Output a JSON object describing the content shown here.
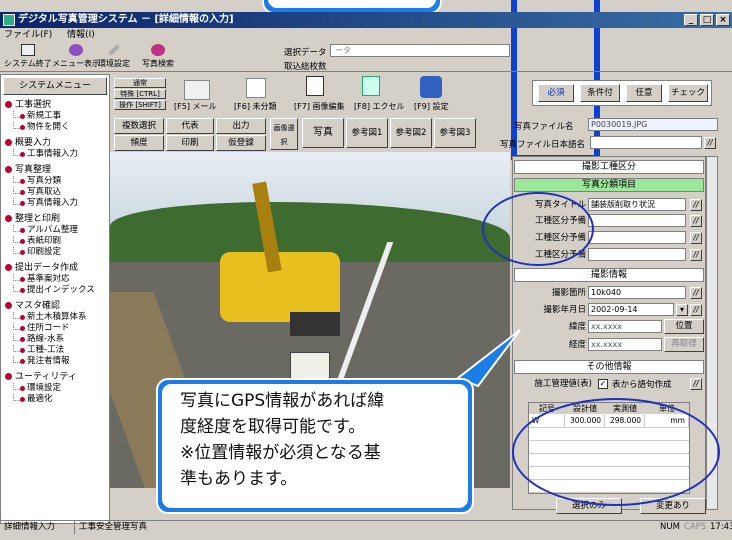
{
  "window": {
    "title": "デジタル写真管理システム － [詳細情報の入力]"
  },
  "menu": [
    "ファイル(F)",
    "情報(I)"
  ],
  "toolbar": [
    {
      "label": "システム終了",
      "icon": "exit-icon"
    },
    {
      "label": "メニュー表示",
      "icon": "menu-icon"
    },
    {
      "label": "環境設定",
      "icon": "settings-icon"
    },
    {
      "label": "写真検索",
      "icon": "search-icon"
    }
  ],
  "select_data": {
    "label": "選択データ",
    "value": "ータ",
    "count_label": "取込総枚数"
  },
  "sidebar": {
    "header": "システムメニュー",
    "groups": [
      {
        "title": "工事選択",
        "items": [
          "新規工事",
          "物件を開く"
        ]
      },
      {
        "title": "概要入力",
        "items": [
          "工事情報入力"
        ]
      },
      {
        "title": "写真整理",
        "items": [
          "写真分類",
          "写真取込",
          "写真情報入力"
        ]
      },
      {
        "title": "整理と印刷",
        "items": [
          "アルバム整理",
          "表紙印刷",
          "印刷設定"
        ]
      },
      {
        "title": "提出データ作成",
        "items": [
          "基準案対応",
          "提出インデックス"
        ]
      },
      {
        "title": "マスタ確認",
        "items": [
          "新土木積算体系",
          "住所コード",
          "路線-水系",
          "工種-工法",
          "発注者情報"
        ]
      },
      {
        "title": "ユーティリティ",
        "items": [
          "環境設定",
          "最適化"
        ]
      }
    ]
  },
  "fkeys": {
    "normal": "通常",
    "ctrl": "特殊 [CTRL]",
    "shift": "操作 [SHIFT]",
    "f5": "[F5] メール",
    "f6": "[F6] 未分類",
    "f7": "[F7] 画像編集",
    "f8": "[F8] エクセル",
    "f9": "[F9] 設定"
  },
  "right_buttons": [
    "必須",
    "条件付",
    "任意",
    "チェック"
  ],
  "tools": {
    "multi_select": "複数選択",
    "representative": "代表",
    "output": "出力",
    "category_select": "画像選択",
    "degree": "頻度",
    "print": "印刷",
    "temp_register": "仮登録"
  },
  "photo_tabs": [
    "写真",
    "参考図1",
    "参考図2",
    "参考図3"
  ],
  "file": {
    "label": "写真ファイル名",
    "value": "P0030019.JPG",
    "jp_label": "写真ファイル日本語名"
  },
  "sections": {
    "shooting_category": "撮影工種区分",
    "photo_class": "写真分類項目",
    "shooting_info": "撮影情報",
    "other_info": "その他情報"
  },
  "fields": {
    "photo_title_label": "写真タイトル",
    "photo_title_value": "舗装版削取り状況",
    "spare1": "工種区分予備",
    "spare2": "工種区分予備",
    "spare3": "工種区分予備",
    "location_label": "撮影箇所",
    "location_value": "10k040",
    "date_label": "撮影年月日",
    "date_value": "2002-09-14",
    "lat_label": "緯度",
    "lat_value": "xx.xxxx",
    "lng_label": "経度",
    "lng_value": "xx.xxxx",
    "position_btn": "位置",
    "reacquire_btn": "再取得",
    "mgmt_label": "施工管理値(表)",
    "mgmt_btn": "表から語句作成"
  },
  "table": {
    "headers": [
      "記号",
      "設計値",
      "実測値",
      "単位"
    ],
    "rows": [
      [
        "W",
        "300.000",
        "298.000",
        "mm"
      ],
      [
        "",
        "",
        "",
        ""
      ],
      [
        "",
        "",
        "",
        ""
      ],
      [
        "",
        "",
        "",
        ""
      ],
      [
        "",
        "",
        "",
        ""
      ],
      [
        "",
        "",
        "",
        ""
      ]
    ]
  },
  "bottom_buttons": {
    "select_only": "選択のみ",
    "change": "変更あり"
  },
  "status": {
    "left": "詳細情報入力",
    "mid": "工事安全管理写真",
    "num": "NUM",
    "caps": "CAPS",
    "time": "17:43"
  },
  "callout": {
    "lines": [
      "写真にGPS情報があれば緯",
      "度経度を取得可能です。",
      "※位置情報が必須となる基",
      "準もあります。"
    ]
  },
  "colors": {
    "title_bar": "#0a246a",
    "highlight": "#9be89b",
    "annotation_blue": "#1c7de8",
    "ellipse": "#2030c0"
  }
}
